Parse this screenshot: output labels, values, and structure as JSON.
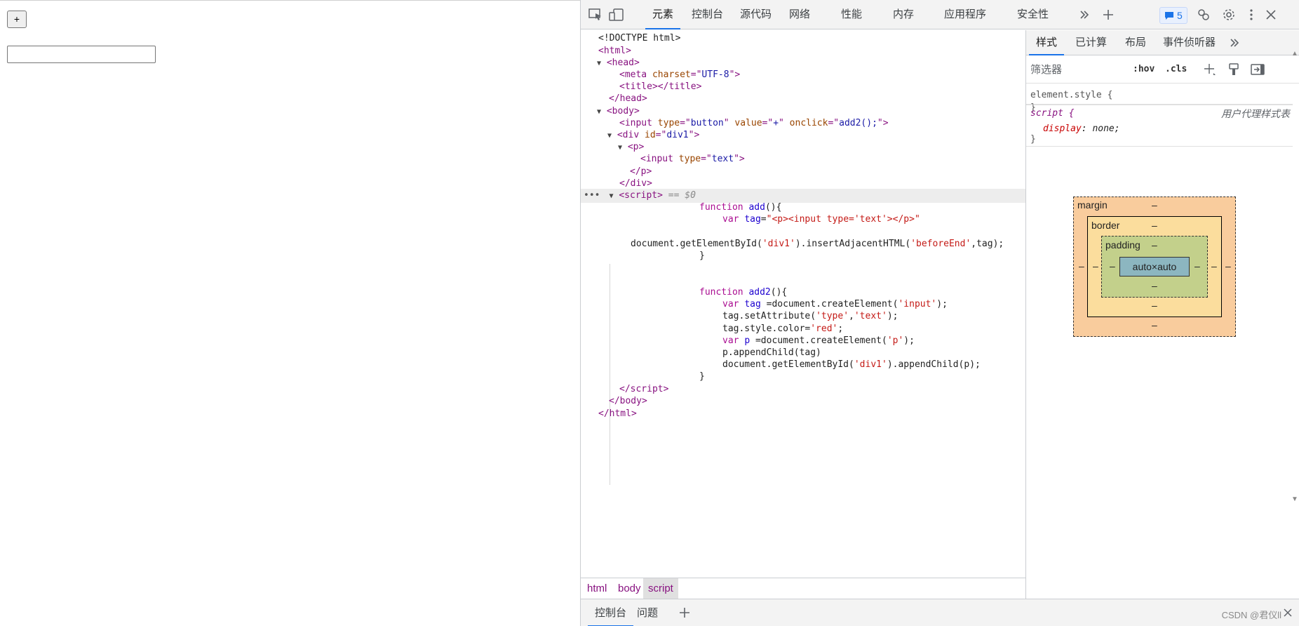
{
  "page": {
    "button_value": "+",
    "text_input_value": ""
  },
  "devtools": {
    "tabs": [
      "元素",
      "控制台",
      "源代码",
      "网络",
      "性能",
      "内存",
      "应用程序",
      "安全性"
    ],
    "active_tab": "元素",
    "issues_count": "5",
    "icons": {
      "inspect": "inspect-element-icon",
      "device": "device-toolbar-icon",
      "more_tabs": "double-chevron-icon",
      "add_tab": "plus-icon",
      "issues": "message-icon",
      "customize": "customize-icon",
      "settings": "gear-icon",
      "menu": "kebab-icon",
      "close": "close-icon"
    },
    "accent_color": "#1a73e8"
  },
  "elements": {
    "doctype": "<!DOCTYPE html>",
    "selected_hint": "== $0",
    "ellipsis": "•••",
    "code_lines": [
      "function add(){",
      "var tag=\"<p><input type='text'></p>\"",
      "document.getElementById('div1').insertAdjacentHTML('beforeEnd',tag);",
      "}",
      "function add2(){",
      "var tag =document.createElement('input');",
      "tag.setAttribute('type','text');",
      "tag.style.color='red';",
      "var p =document.createElement('p');",
      "p.appendChild(tag)",
      "document.getElementById('div1').appendChild(p);",
      "}"
    ]
  },
  "breadcrumbs": [
    "html",
    "body",
    "script"
  ],
  "styles": {
    "tabs": [
      "样式",
      "已计算",
      "布局",
      "事件侦听器"
    ],
    "filter_placeholder": "筛选器",
    "hov": ":hov",
    "cls": ".cls",
    "element_style": "element.style {",
    "close_brace": "}",
    "rule_selector": "script {",
    "ua_label": "用户代理样式表",
    "prop_name": "display",
    "prop_value": "none;"
  },
  "box_model": {
    "margin_label": "margin",
    "border_label": "border",
    "padding_label": "padding",
    "content_label": "auto×auto",
    "dash": "–"
  },
  "drawer": {
    "tabs": [
      "控制台",
      "问题"
    ],
    "watermark": "CSDN @君仪ll"
  }
}
